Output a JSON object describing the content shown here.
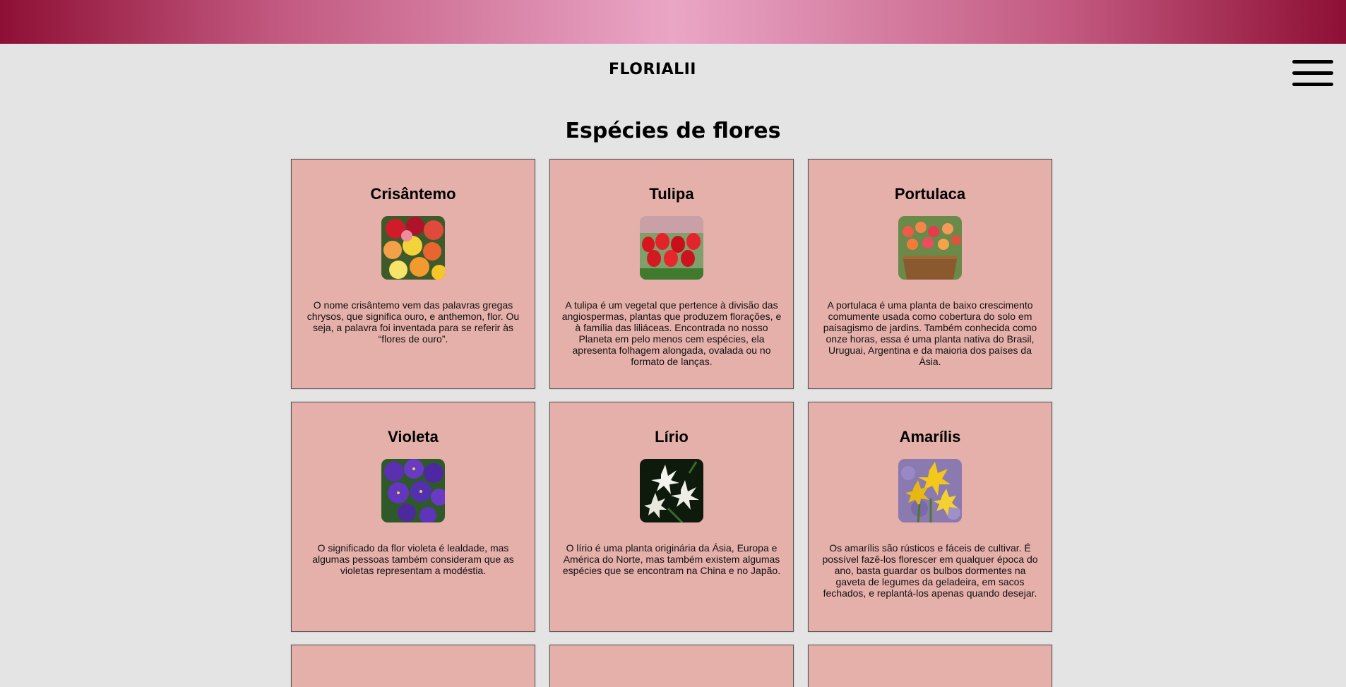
{
  "header": {
    "brand": "FLORIALII",
    "menu_icon": "hamburger-menu-icon"
  },
  "page": {
    "title": "Espécies de flores"
  },
  "colors": {
    "card_bg": "#e5b0aa",
    "topbar_dark": "#8e0f35",
    "topbar_light": "#eaa6c6",
    "page_bg": "#e4e4e4"
  },
  "cards": [
    {
      "name": "Crisântemo",
      "image": "chrysanthemum-photo",
      "description": "O nome crisântemo vem das palavras gregas chrysos, que significa ouro, e anthemon, flor. Ou seja, a palavra foi inventada para se referir às “flores de ouro”."
    },
    {
      "name": "Tulipa",
      "image": "tulip-photo",
      "description": "A tulipa é um vegetal que pertence à divisão das angiospermas, plantas que produzem florações, e à família das liliáceas. Encontrada no nosso Planeta em pelo menos cem espécies, ela apresenta folhagem alongada, ovalada ou no formato de lanças."
    },
    {
      "name": "Portulaca",
      "image": "portulaca-photo",
      "description": "A portulaca é uma planta de baixo crescimento comumente usada como cobertura do solo em paisagismo de jardins. Também conhecida como onze horas, essa é uma planta nativa do Brasil, Uruguai, Argentina e da maioria dos países da Ásia."
    },
    {
      "name": "Violeta",
      "image": "violet-photo",
      "description": "O significado da flor violeta é lealdade, mas algumas pessoas também consideram que as violetas representam a modéstia."
    },
    {
      "name": "Lírio",
      "image": "lily-photo",
      "description": "O lírio é uma planta originária da Ásia, Europa e América do Norte, mas também existem algumas espécies que se encontram na China e no Japão."
    },
    {
      "name": "Amarílis",
      "image": "amaryllis-photo",
      "description": "Os amarílis são rústicos e fáceis de cultivar. É possível fazê-los florescer em qualquer época do ano, basta guardar os bulbos dormentes na gaveta de legumes da geladeira, em sacos fechados, e replantá-los apenas quando desejar."
    }
  ]
}
